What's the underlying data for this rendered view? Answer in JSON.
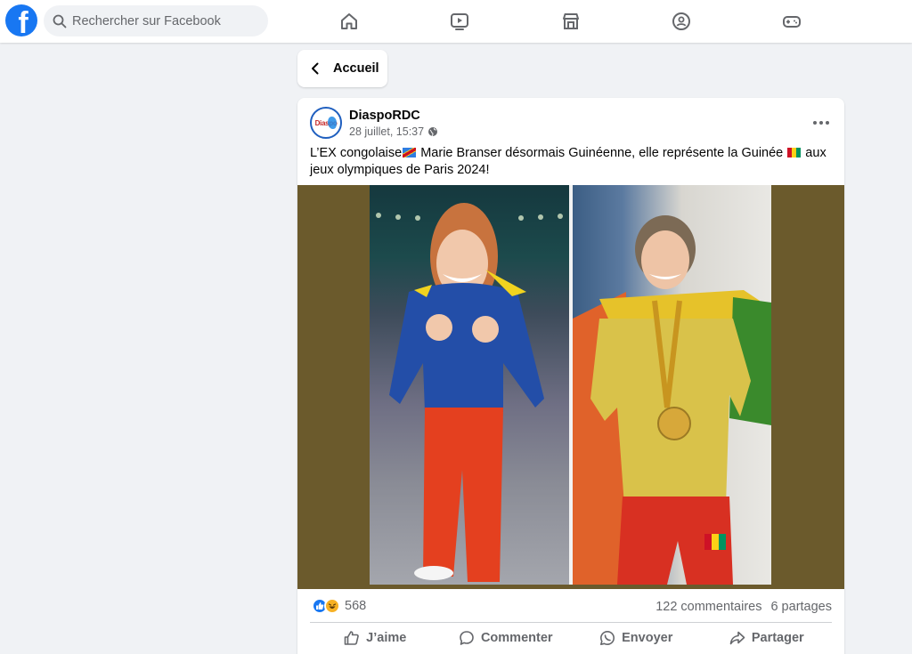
{
  "topbar": {
    "logo_letter": "f",
    "search_placeholder": "Rechercher sur Facebook",
    "nav_icons": [
      "home-icon",
      "video-icon",
      "marketplace-icon",
      "groups-icon",
      "gaming-icon"
    ]
  },
  "back_button": {
    "label": "Accueil"
  },
  "post": {
    "author": "DiaspoRDC",
    "avatar_text": "Diaspo",
    "timestamp": "28 juillet, 15:37",
    "text_part1": "L’EX congolaise",
    "text_part2": " Marie Branser désormais Guinéenne, elle représente la Guinée ",
    "text_part3": " aux jeux olympiques de Paris 2024!",
    "reaction_count": "568",
    "comments": "122 commentaires",
    "shares": "6 partages",
    "actions": {
      "like": "J’aime",
      "comment": "Commenter",
      "send": "Envoyer",
      "share": "Partager"
    }
  },
  "colors": {
    "brand": "#1877f2",
    "media_background": "#6b5a2c",
    "secondary_text": "#65676b"
  }
}
